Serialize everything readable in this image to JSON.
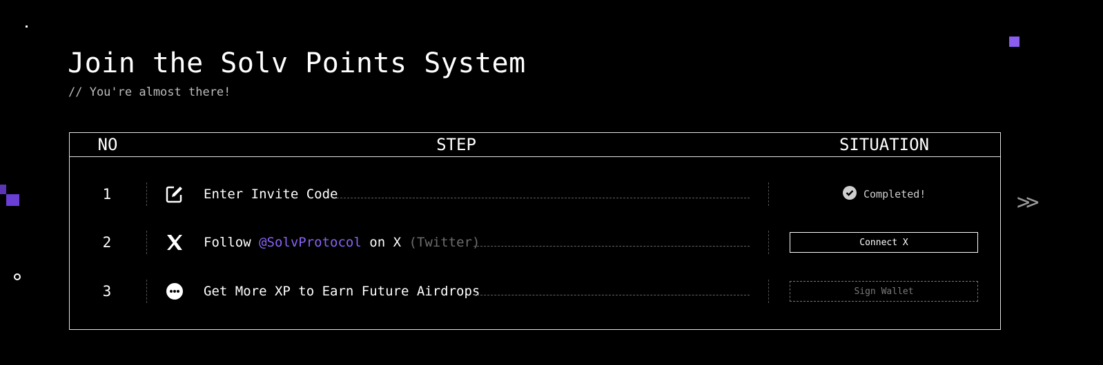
{
  "header": {
    "title": "Join the Solv Points System",
    "subtitle": "// You're almost there!"
  },
  "table": {
    "columns": {
      "no": "NO",
      "step": "STEP",
      "situation": "SITUATION"
    },
    "rows": [
      {
        "no": "1",
        "icon": "edit-icon",
        "text": "Enter Invite Code",
        "status": "Completed!",
        "status_icon": "check-circle-icon"
      },
      {
        "no": "2",
        "icon": "x-logo-icon",
        "text_prefix": "Follow",
        "handle": "@SolvProtocol",
        "text_mid": "on X",
        "text_suffix": "(Twitter)",
        "action": "Connect X"
      },
      {
        "no": "3",
        "icon": "more-icon",
        "text": "Get More XP to Earn Future Airdrops",
        "action": "Sign Wallet"
      }
    ]
  },
  "colors": {
    "accent": "#8a63f5",
    "deco_purple": "#6a3fd6",
    "background": "#000000",
    "border": "#e6e6e6"
  },
  "decorations": {
    "next_arrows": ">>"
  }
}
